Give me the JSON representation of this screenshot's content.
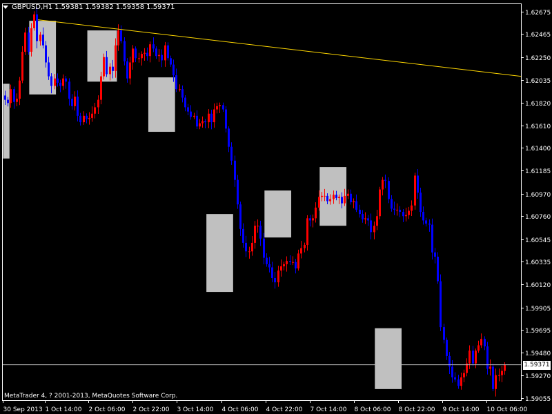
{
  "header": {
    "symbol_timeframe": "GBPUSD,H1",
    "open": "1.59381",
    "high": "1.59382",
    "low": "1.59358",
    "close": "1.59371"
  },
  "copyright": "MetaTrader 4, ? 2001-2013, MetaQuotes Software Corp.",
  "current_price_label": "1.59371",
  "colors": {
    "background": "#000000",
    "axis": "#ffffff",
    "bull_candle": "#ff0000",
    "bear_candle": "#0000ff",
    "session_box": "#c0c0c0",
    "trendline": "#ffd700",
    "bid_line": "#c0c0c0"
  },
  "chart_data": {
    "type": "candlestick",
    "symbol": "GBPUSD",
    "timeframe": "H1",
    "y_ticks": [
      "1.62675",
      "1.62465",
      "1.62250",
      "1.62035",
      "1.61820",
      "1.61610",
      "1.61400",
      "1.61185",
      "1.60970",
      "1.60760",
      "1.60545",
      "1.60335",
      "1.60120",
      "1.59905",
      "1.59695",
      "1.59480",
      "1.59270",
      "1.59055"
    ],
    "ylim": [
      1.59,
      1.6279
    ],
    "x_ticks": [
      "30 Sep 2013",
      "1 Oct 14:00",
      "2 Oct 06:00",
      "2 Oct 22:00",
      "3 Oct 14:00",
      "4 Oct 06:00",
      "4 Oct 22:00",
      "7 Oct 14:00",
      "8 Oct 06:00",
      "8 Oct 22:00",
      "9 Oct 14:00",
      "10 Oct 06:00"
    ],
    "current_price": 1.59371,
    "trendline": {
      "start": 1.626,
      "end": 1.6207
    },
    "closes": [
      1.6185,
      1.6182,
      1.6195,
      1.6183,
      1.6186,
      1.6203,
      1.623,
      1.6248,
      1.623,
      1.6252,
      1.6265,
      1.624,
      1.6246,
      1.6236,
      1.622,
      1.6207,
      1.6198,
      1.6205,
      1.6201,
      1.6198,
      1.6205,
      1.6202,
      1.6186,
      1.6179,
      1.6188,
      1.617,
      1.6164,
      1.617,
      1.6167,
      1.6168,
      1.6172,
      1.6178,
      1.6185,
      1.6207,
      1.6225,
      1.6209,
      1.6216,
      1.6212,
      1.6236,
      1.625,
      1.624,
      1.6221,
      1.6205,
      1.622,
      1.6233,
      1.6224,
      1.6224,
      1.6228,
      1.6229,
      1.6226,
      1.6237,
      1.6233,
      1.6226,
      1.6227,
      1.6222,
      1.6236,
      1.6224,
      1.6218,
      1.6208,
      1.6195,
      1.6195,
      1.6187,
      1.6178,
      1.6174,
      1.6169,
      1.617,
      1.616,
      1.6163,
      1.6165,
      1.6164,
      1.6172,
      1.6164,
      1.6176,
      1.6179,
      1.618,
      1.6176,
      1.6158,
      1.6141,
      1.6128,
      1.611,
      1.6087,
      1.6064,
      1.6051,
      1.6043,
      1.6043,
      1.6051,
      1.6067,
      1.6067,
      1.6055,
      1.6037,
      1.6031,
      1.6028,
      1.6018,
      1.6014,
      1.6025,
      1.6029,
      1.6031,
      1.6034,
      1.6033,
      1.6033,
      1.6027,
      1.6041,
      1.6046,
      1.6049,
      1.6074,
      1.6072,
      1.6074,
      1.6084,
      1.6094,
      1.6095,
      1.6095,
      1.609,
      1.6092,
      1.6096,
      1.6093,
      1.6094,
      1.6088,
      1.6095,
      1.6097,
      1.6089,
      1.609,
      1.6082,
      1.6078,
      1.6073,
      1.6074,
      1.6072,
      1.6061,
      1.6067,
      1.6076,
      1.6101,
      1.611,
      1.6109,
      1.6092,
      1.6083,
      1.6082,
      1.6082,
      1.608,
      1.6076,
      1.6077,
      1.6081,
      1.6086,
      1.6114,
      1.6098,
      1.608,
      1.6072,
      1.6069,
      1.6068,
      1.6042,
      1.6038,
      1.6015,
      1.5972,
      1.596,
      1.5945,
      1.5935,
      1.5925,
      1.5923,
      1.5917,
      1.5925,
      1.5929,
      1.5938,
      1.595,
      1.5938,
      1.595,
      1.5955,
      1.5961,
      1.5954,
      1.5933,
      1.5935,
      1.5914,
      1.5927,
      1.5927,
      1.5931,
      1.5937
    ],
    "session_boxes": [
      {
        "i0": 0,
        "i1": 1,
        "lo": 1.613,
        "hi": 1.62
      },
      {
        "i0": 9,
        "i1": 17,
        "lo": 1.619,
        "hi": 1.6259
      },
      {
        "i0": 29,
        "i1": 38,
        "lo": 1.6202,
        "hi": 1.625
      },
      {
        "i0": 50,
        "i1": 58,
        "lo": 1.6155,
        "hi": 1.6206
      },
      {
        "i0": 70,
        "i1": 78,
        "lo": 1.6005,
        "hi": 1.6078
      },
      {
        "i0": 90,
        "i1": 98,
        "lo": 1.6056,
        "hi": 1.61
      },
      {
        "i0": 109,
        "i1": 117,
        "lo": 1.6067,
        "hi": 1.6122
      },
      {
        "i0": 128,
        "i1": 136,
        "lo": 1.5914,
        "hi": 1.5971
      }
    ]
  }
}
